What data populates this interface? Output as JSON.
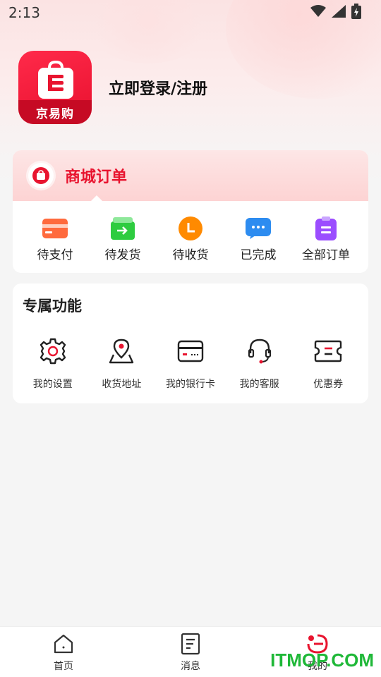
{
  "status_bar": {
    "time": "2:13"
  },
  "profile": {
    "logo_text": "京易购",
    "login_label": "立即登录/注册"
  },
  "orders": {
    "title": "商城订单",
    "items": [
      {
        "label": "待支付",
        "icon": "card-icon",
        "color": "#ff5a3c"
      },
      {
        "label": "待发货",
        "icon": "box-arrow-icon",
        "color": "#2ecc40"
      },
      {
        "label": "待收货",
        "icon": "clock-icon",
        "color": "#ff8a00"
      },
      {
        "label": "已完成",
        "icon": "chat-icon",
        "color": "#2d8cf0"
      },
      {
        "label": "全部订单",
        "icon": "clipboard-icon",
        "color": "#8e44ff"
      }
    ]
  },
  "functions": {
    "title": "专属功能",
    "items": [
      {
        "label": "我的设置",
        "icon": "gear-icon"
      },
      {
        "label": "收货地址",
        "icon": "location-pin-icon"
      },
      {
        "label": "我的银行卡",
        "icon": "bank-card-icon"
      },
      {
        "label": "我的客服",
        "icon": "headset-icon"
      },
      {
        "label": "优惠券",
        "icon": "coupon-icon"
      }
    ]
  },
  "tab_bar": {
    "items": [
      {
        "label": "首页",
        "icon": "home-icon"
      },
      {
        "label": "消息",
        "icon": "message-icon"
      },
      {
        "label": "我的",
        "icon": "profile-icon",
        "active": true
      }
    ]
  },
  "watermark": "ITMOP.COM",
  "colors": {
    "brand_red": "#e8142f",
    "accent_dark": "#222222"
  }
}
